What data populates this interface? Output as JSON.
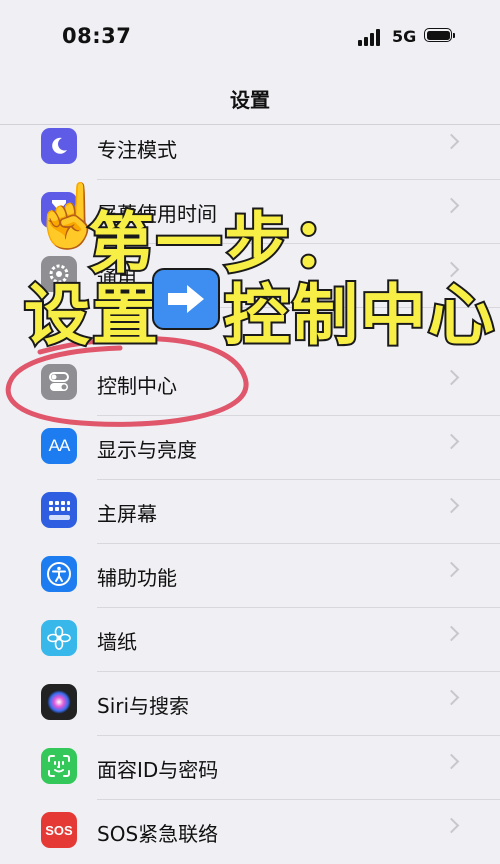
{
  "status_bar": {
    "time": "08:37",
    "network": "5G"
  },
  "nav": {
    "title": "设置"
  },
  "rows": [
    {
      "label": "专注模式",
      "icon": "moon-icon",
      "color": "#5e5ce6"
    },
    {
      "label": "屏幕使用时间",
      "icon": "hourglass-icon",
      "color": "#5e5ce6"
    },
    {
      "label": "通用",
      "icon": "gear-icon",
      "color": "#8e8e93"
    },
    {
      "label": "控制中心",
      "icon": "toggles-icon",
      "color": "#8e8e93"
    },
    {
      "label": "显示与亮度",
      "icon": "text-size-icon",
      "color": "#1c7cf0"
    },
    {
      "label": "主屏幕",
      "icon": "home-grid-icon",
      "color": "#2f5ee0"
    },
    {
      "label": "辅助功能",
      "icon": "accessibility-icon",
      "color": "#1c7cf0"
    },
    {
      "label": "墙纸",
      "icon": "flower-icon",
      "color": "#38b7ea"
    },
    {
      "label": "Siri与搜索",
      "icon": "siri-icon",
      "color": "#222222"
    },
    {
      "label": "面容ID与密码",
      "icon": "face-id-icon",
      "color": "#34c759"
    },
    {
      "label": "SOS紧急联络",
      "icon": "sos-icon",
      "color": "#e53935"
    }
  ],
  "overlay": {
    "line1": "第一步：",
    "line2a": "设置",
    "line2b": "控制中心",
    "colors": {
      "text": "#f7ef45",
      "circle": "#e0566a",
      "arrow_box": "#3d8ef0"
    }
  }
}
